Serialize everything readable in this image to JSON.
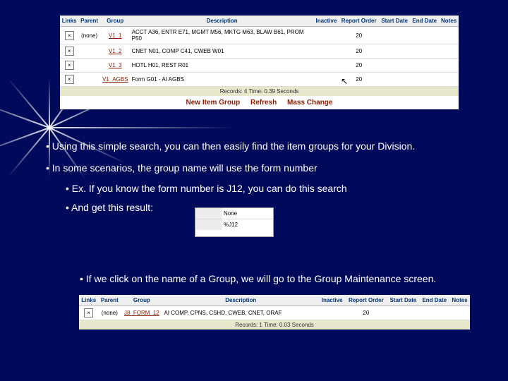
{
  "table1": {
    "headers": [
      "Links",
      "Parent",
      "Group",
      "Description",
      "Inactive",
      "Report Order",
      "Start Date",
      "End Date",
      "Notes"
    ],
    "rows": [
      {
        "parent": "(none)",
        "group": "V1_1",
        "desc": "ACCT A36, ENTR E71, MGMT M56, MKTG M63, BLAW B61, PROM P50",
        "order": "20"
      },
      {
        "parent": "",
        "group": "V1_2",
        "desc": "CNET N01, COMP C41, CWEB W01",
        "order": "20"
      },
      {
        "parent": "",
        "group": "V1_3",
        "desc": "HOTL H01, REST R01",
        "order": "20"
      },
      {
        "parent": "",
        "group": "V1_AGBS",
        "desc": "Form G01 - AI AGBS",
        "order": "20"
      }
    ],
    "records": "Records: 4  Time: 0.39 Seconds",
    "actions": {
      "new": "New Item Group",
      "refresh": "Refresh",
      "mass": "Mass Change"
    }
  },
  "bullets": {
    "b1": "• Using this simple search, you can then easily find the item groups for your Division.",
    "b2": "• In some scenarios, the group name will use the form number",
    "b3": "• Ex. If you know the form number is J12, you can do this search",
    "b4": "• And get this result:",
    "b5": "• If we click on the name of a Group, we will go to the Group Maintenance screen."
  },
  "mini": {
    "r1_label": "",
    "r1_val": "None",
    "r2_label": "",
    "r2_val": "%J12"
  },
  "table2": {
    "headers": [
      "Links",
      "Parent",
      "Group",
      "Description",
      "Inactive",
      "Report Order",
      "Start Date",
      "End Date",
      "Notes"
    ],
    "row": {
      "parent": "(none)",
      "group": "J8_FORM_12",
      "desc": "AI COMP, CPNS, CSHD, CWEB, CNET, ORAF",
      "order": "20"
    },
    "records": "Records: 1  Time: 0.03 Seconds"
  }
}
